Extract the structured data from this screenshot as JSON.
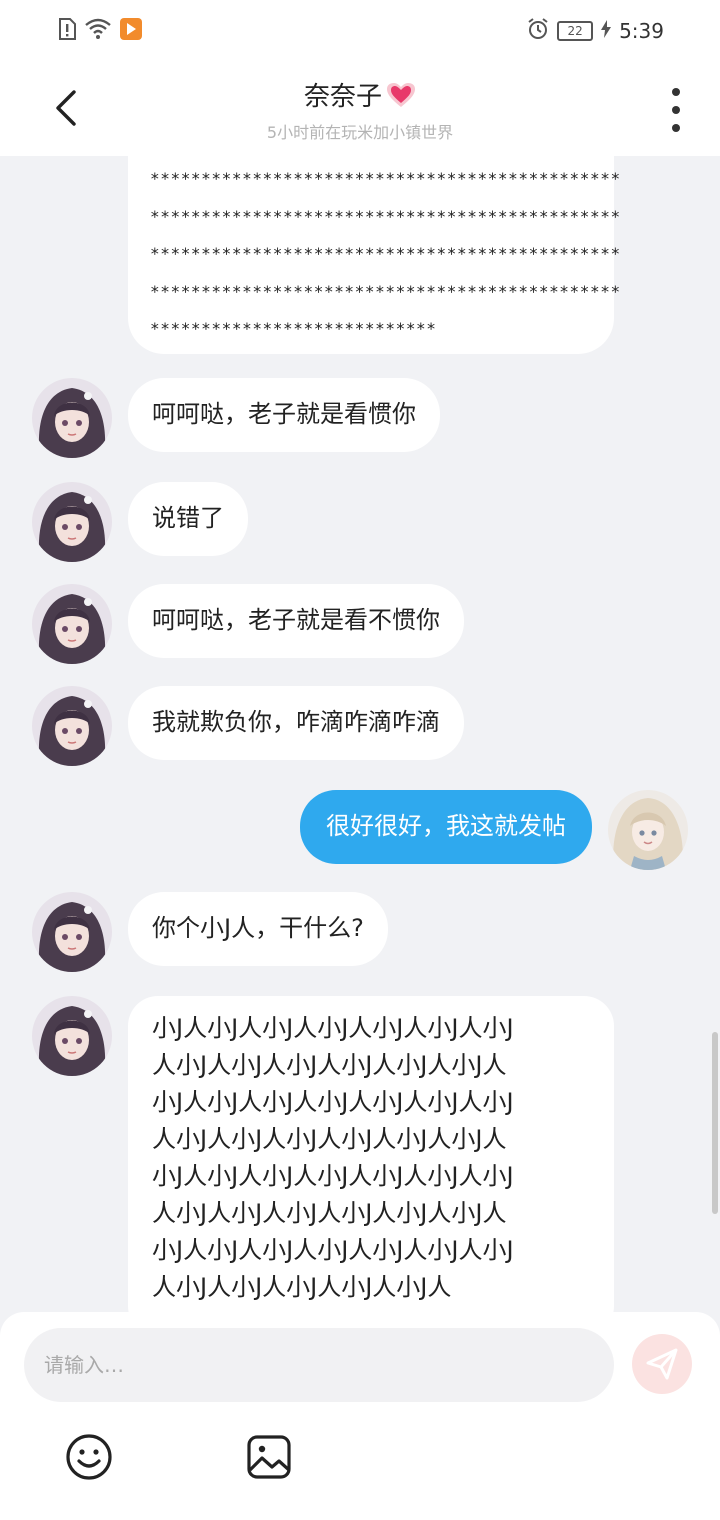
{
  "status": {
    "time": "5:39",
    "battery": "22"
  },
  "header": {
    "title": "奈奈子",
    "subtitle": "5小时前在玩米加小镇世界"
  },
  "messages": [
    {
      "side": "left",
      "kind": "stars",
      "lines": [
        "**********************************************",
        "**********************************************",
        "**********************************************",
        "**********************************************",
        "****************************"
      ]
    },
    {
      "side": "left",
      "text": "呵呵哒，老子就是看惯你"
    },
    {
      "side": "left",
      "text": "说错了"
    },
    {
      "side": "left",
      "text": "呵呵哒，老子就是看不惯你"
    },
    {
      "side": "left",
      "text": "我就欺负你，咋滴咋滴咋滴"
    },
    {
      "side": "right",
      "text": "很好很好，我这就发帖"
    },
    {
      "side": "left",
      "text": "你个小J人，干什么?"
    },
    {
      "side": "left",
      "lines": [
        "小J人小J人小J人小J人小J人小J人小J",
        "人小J人小J人小J人小J人小J人小J人",
        "小J人小J人小J人小J人小J人小J人小J",
        "人小J人小J人小J人小J人小J人小J人",
        "小J人小J人小J人小J人小J人小J人小J",
        "人小J人小J人小J人小J人小J人小J人",
        "小J人小J人小J人小J人小J人小J人小J",
        "人小J人小J人小J人小J人小J人"
      ]
    }
  ],
  "composer": {
    "placeholder": "请输入…"
  },
  "colors": {
    "accent": "#2fa9ee",
    "send_disabled": "#fbe2e1",
    "background": "#f1f2f5"
  },
  "icons": {
    "back": "chevron-left-icon",
    "more": "more-vertical-icon",
    "heart": "heart-icon",
    "send": "send-icon",
    "emoji": "smiley-icon",
    "image": "image-icon"
  }
}
